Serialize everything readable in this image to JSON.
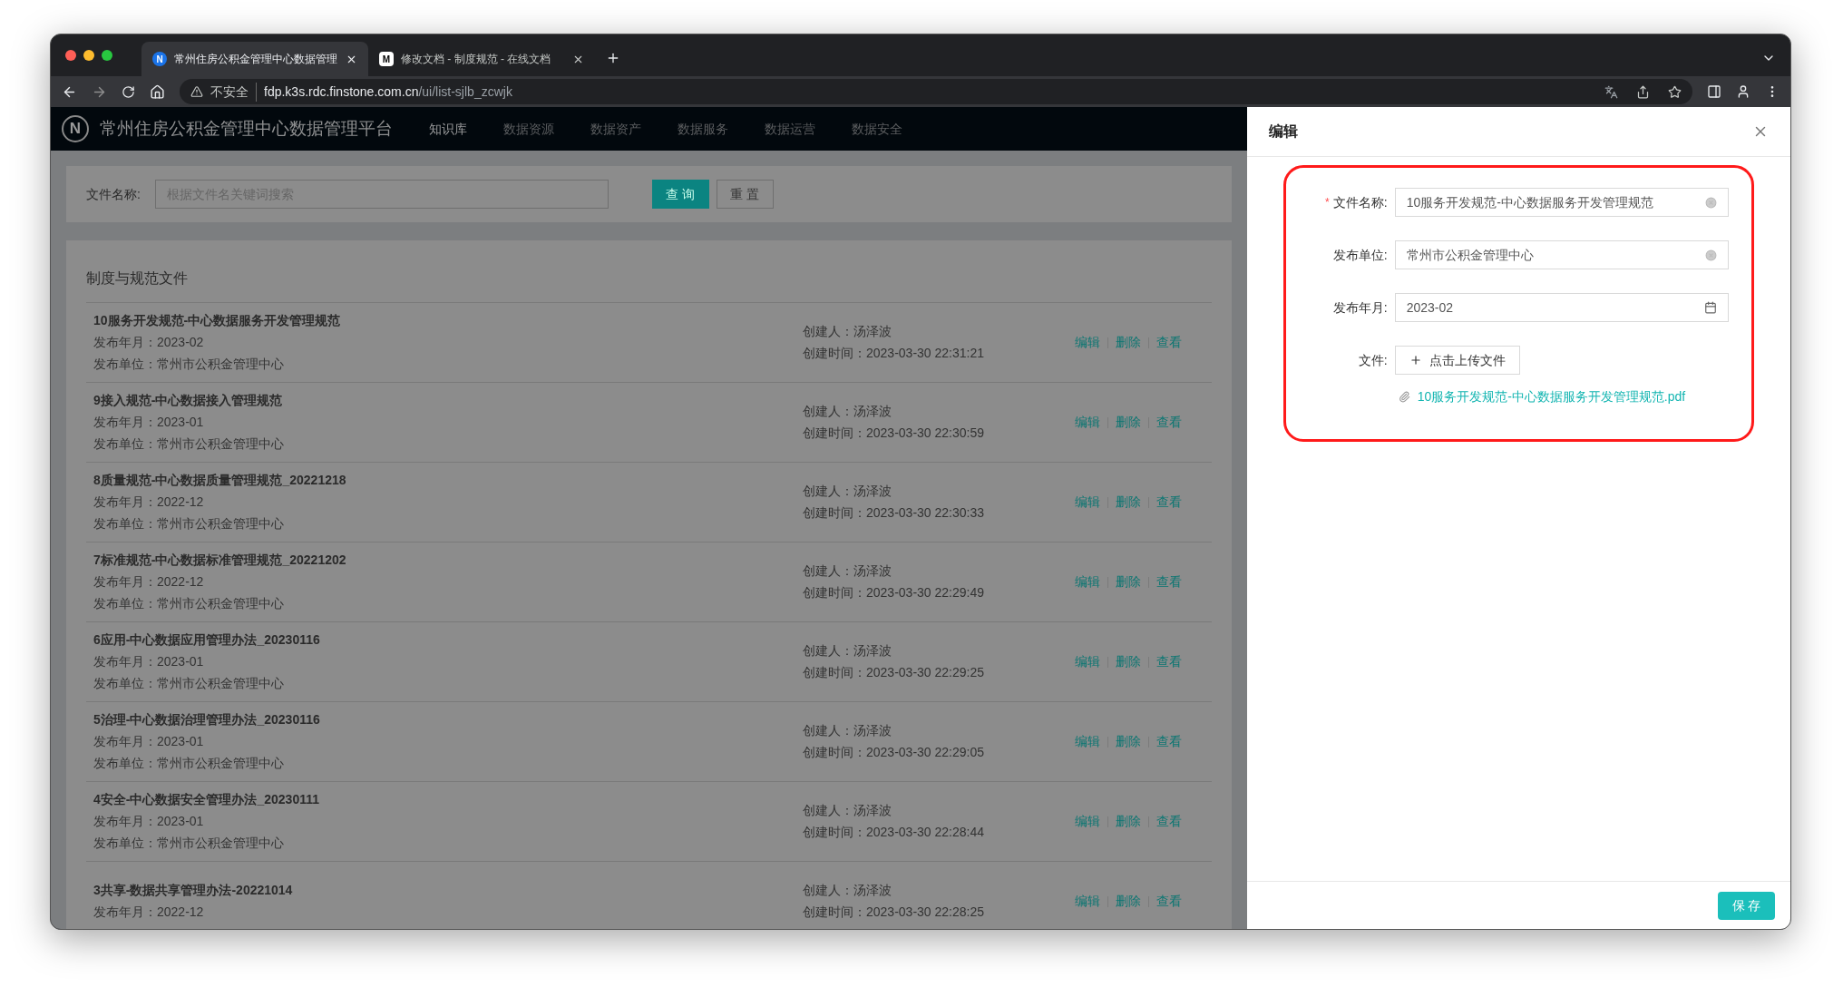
{
  "browser": {
    "tabs": [
      {
        "title": "常州住房公积金管理中心数据管理",
        "selected": true,
        "icon": "N"
      },
      {
        "title": "修改文档 - 制度规范 - 在线文档",
        "selected": false,
        "icon": "M"
      }
    ],
    "security": "不安全",
    "url_host": "fdp.k3s.rdc.finstone.com.cn",
    "url_path": "/ui/list-sjlb_zcwjk"
  },
  "app": {
    "logo": "N",
    "title": "常州住房公积金管理中心数据管理平台",
    "nav": [
      {
        "label": "知识库",
        "selected": true
      },
      {
        "label": "数据资源",
        "selected": false
      },
      {
        "label": "数据资产",
        "selected": false
      },
      {
        "label": "数据服务",
        "selected": false
      },
      {
        "label": "数据运营",
        "selected": false
      },
      {
        "label": "数据安全",
        "selected": false
      }
    ]
  },
  "search": {
    "label": "文件名称:",
    "placeholder": "根据文件名关键词搜索",
    "buttons": [
      {
        "label": "查 询",
        "kind": "primary"
      },
      {
        "label": "重 置",
        "kind": "default"
      }
    ]
  },
  "list": {
    "title": "制度与规范文件",
    "rows": [
      {
        "name": "10服务开发规范-中心数据服务开发管理规范",
        "date": "发布年月：2023-02",
        "unit": "发布单位：常州市公积金管理中心",
        "creator": "创建人：汤泽波",
        "created": "创建时间：2023-03-30 22:31:21",
        "actions": [
          "编辑",
          "删除",
          "查看"
        ]
      },
      {
        "name": "9接入规范-中心数据接入管理规范",
        "date": "发布年月：2023-01",
        "unit": "发布单位：常州市公积金管理中心",
        "creator": "创建人：汤泽波",
        "created": "创建时间：2023-03-30 22:30:59",
        "actions": [
          "编辑",
          "删除",
          "查看"
        ]
      },
      {
        "name": "8质量规范-中心数据质量管理规范_20221218",
        "date": "发布年月：2022-12",
        "unit": "发布单位：常州市公积金管理中心",
        "creator": "创建人：汤泽波",
        "created": "创建时间：2023-03-30 22:30:33",
        "actions": [
          "编辑",
          "删除",
          "查看"
        ]
      },
      {
        "name": "7标准规范-中心数据标准管理规范_20221202",
        "date": "发布年月：2022-12",
        "unit": "发布单位：常州市公积金管理中心",
        "creator": "创建人：汤泽波",
        "created": "创建时间：2023-03-30 22:29:49",
        "actions": [
          "编辑",
          "删除",
          "查看"
        ]
      },
      {
        "name": "6应用-中心数据应用管理办法_20230116",
        "date": "发布年月：2023-01",
        "unit": "发布单位：常州市公积金管理中心",
        "creator": "创建人：汤泽波",
        "created": "创建时间：2023-03-30 22:29:25",
        "actions": [
          "编辑",
          "删除",
          "查看"
        ]
      },
      {
        "name": "5治理-中心数据治理管理办法_20230116",
        "date": "发布年月：2023-01",
        "unit": "发布单位：常州市公积金管理中心",
        "creator": "创建人：汤泽波",
        "created": "创建时间：2023-03-30 22:29:05",
        "actions": [
          "编辑",
          "删除",
          "查看"
        ]
      },
      {
        "name": "4安全-中心数据安全管理办法_20230111",
        "date": "发布年月：2023-01",
        "unit": "发布单位：常州市公积金管理中心",
        "creator": "创建人：汤泽波",
        "created": "创建时间：2023-03-30 22:28:44",
        "actions": [
          "编辑",
          "删除",
          "查看"
        ]
      },
      {
        "name": "3共享-数据共享管理办法-20221014",
        "date": "发布年月：2022-12",
        "creator": "创建人：汤泽波",
        "created": "创建时间：2023-03-30 22:28:25",
        "actions": [
          "编辑",
          "删除",
          "查看"
        ]
      }
    ]
  },
  "drawer": {
    "title": "编辑",
    "fields": [
      {
        "label": "文件名称:",
        "required_mark": "*",
        "value": "10服务开发规范-中心数据服务开发管理规范",
        "kind": "clearable"
      },
      {
        "label": "发布单位:",
        "value": "常州市公积金管理中心",
        "kind": "clearable"
      },
      {
        "label": "发布年月:",
        "value": "2023-02",
        "kind": "date"
      },
      {
        "label": "文件:",
        "kind": "upload",
        "button": "点击上传文件",
        "file": "10服务开发规范-中心数据服务开发管理规范.pdf"
      }
    ],
    "save": "保 存"
  }
}
